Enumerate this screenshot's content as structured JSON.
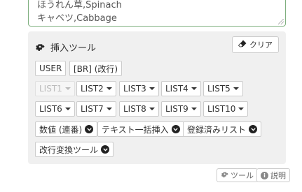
{
  "textarea": {
    "lines": [
      "ほうれん草,Spinach",
      "キャベツ,Cabbage"
    ]
  },
  "panel": {
    "title": "挿入ツール",
    "clear_label": "クリア",
    "buttons_row1": [
      "USER",
      "[BR] (改行)"
    ],
    "list_row1": [
      "LIST1",
      "LIST2",
      "LIST3",
      "LIST4",
      "LIST5"
    ],
    "list_row2": [
      "LIST6",
      "LIST7",
      "LIST8",
      "LIST9",
      "LIST10"
    ],
    "tools_row": [
      "数値 (連番)",
      "テキスト一括挿入",
      "登録済みリスト"
    ],
    "tools_row2": [
      "改行変換ツール"
    ]
  },
  "footer": {
    "tools_label": "ツール",
    "help_label": "説明"
  },
  "icons": {
    "gear": "gear-icon",
    "eraser": "eraser-icon",
    "chevron": "chevron-circle-down-icon",
    "info": "info-icon"
  }
}
